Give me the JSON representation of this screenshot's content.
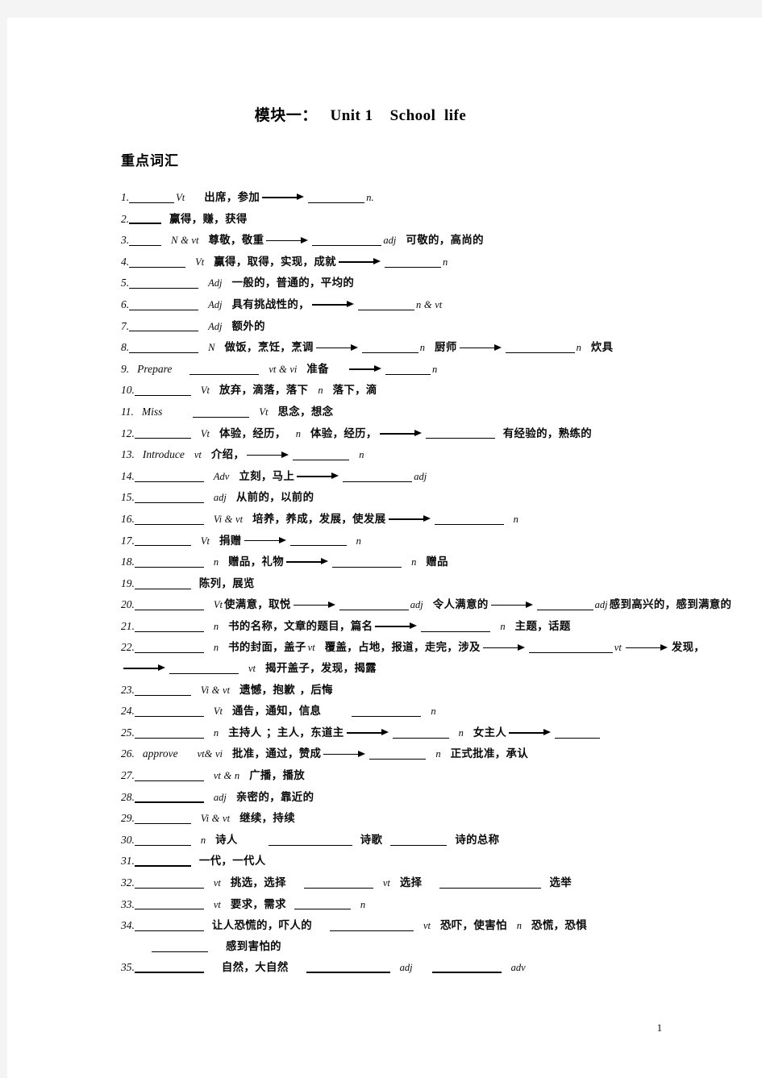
{
  "document": {
    "title": "模块一：   Unit 1    School  life",
    "section_heading": "重点词汇",
    "page_number": "1"
  },
  "entries": [
    {
      "num": "1.",
      "word": "",
      "pos": "Vt",
      "cn": "出席，参加",
      "pos2": "n.",
      "cn2": ""
    },
    {
      "num": "2.",
      "word": "",
      "pos": "",
      "cn": "赢得，赚，获得"
    },
    {
      "num": "3.",
      "word": "",
      "pos": "N & vt",
      "cn": "尊敬，敬重",
      "pos2": "adj",
      "cn2": "可敬的，高尚的"
    },
    {
      "num": "4.",
      "word": "",
      "pos": "Vt",
      "cn": "赢得，取得，实现，成就",
      "pos2": "n"
    },
    {
      "num": "5.",
      "word": "",
      "pos": "Adj",
      "cn": "一般的，普通的，平均的"
    },
    {
      "num": "6.",
      "word": "",
      "pos": "Adj",
      "cn": "具有挑战性的，",
      "pos2": "n & vt"
    },
    {
      "num": "7.",
      "word": "",
      "pos": "Adj",
      "cn": "额外的"
    },
    {
      "num": "8.",
      "word": "",
      "pos": "N",
      "cn": "做饭，烹饪，烹调",
      "pos2": "n",
      "cn2": "厨师",
      "pos3": "n",
      "cn3": "炊具"
    },
    {
      "num": "9.",
      "word": "Prepare",
      "pos": "vt & vi",
      "cn": "准备",
      "pos2": "n"
    },
    {
      "num": "10.",
      "word": "",
      "pos": "Vt",
      "cn": "放弃，滴落，落下",
      "pos2": "n",
      "cn2": "落下，滴"
    },
    {
      "num": "11.",
      "word": "Miss",
      "pos": "Vt",
      "cn": "思念，想念"
    },
    {
      "num": "12.",
      "word": "",
      "pos": "Vt",
      "cn": "体验，经历，",
      "pos2": "n",
      "cn2": "体验，经历，",
      "cn3": "有经验的，熟练的"
    },
    {
      "num": "13.",
      "word": "Introduce",
      "pos": "vt",
      "cn": "介绍，",
      "pos2": "n"
    },
    {
      "num": "14.",
      "word": "",
      "pos": "Adv",
      "cn": "立刻，马上",
      "pos2": "adj"
    },
    {
      "num": "15.",
      "word": "",
      "pos": "adj",
      "cn": "从前的，以前的"
    },
    {
      "num": "16.",
      "word": "",
      "pos": "Vi & vt",
      "cn": "培养，养成，发展，使发展",
      "pos2": "n"
    },
    {
      "num": "17.",
      "word": "",
      "pos": "Vt",
      "cn": "捐赠",
      "pos2": "n"
    },
    {
      "num": "18.",
      "word": "",
      "pos": "n",
      "cn": "赠品，礼物",
      "pos2": "n",
      "cn2": "赠品"
    },
    {
      "num": "19.",
      "word": "",
      "pos": "",
      "cn": "陈列，展览"
    },
    {
      "num": "20.",
      "word": "",
      "pos": "Vt",
      "cn": "使满意，取悦",
      "pos2": "adj",
      "cn2": "令人满意的",
      "pos3": "adj",
      "cn3": "感到高兴的，感到满意的"
    },
    {
      "num": "21.",
      "word": "",
      "pos": "n",
      "cn": "书的名称，文章的题目，篇名",
      "pos2": "n",
      "cn2": "主题，话题"
    },
    {
      "num": "22.",
      "word": "",
      "pos": "n",
      "cn": "书的封面，盖子",
      "pos2": "vt",
      "cn2": "覆盖，占地，报道，走完，涉及",
      "pos3": "vt",
      "cn3": "发现，",
      "pos4": "vt",
      "cn4": "揭开盖子，发现，揭露"
    },
    {
      "num": "23.",
      "word": "",
      "pos": "Vi & vt",
      "cn": "遗憾，抱歉 ，后悔"
    },
    {
      "num": "24.",
      "word": "",
      "pos": "Vt",
      "cn": "通告，通知，信息",
      "pos2": "n"
    },
    {
      "num": "25.",
      "word": "",
      "pos": "n",
      "cn": "主持人 ；主人，东道主",
      "pos2": "n",
      "cn2": "女主人"
    },
    {
      "num": "26.",
      "word": "approve",
      "pos": "vt& vi",
      "cn": "批准，通过，赞成",
      "pos2": "n",
      "cn2": "正式批准，承认"
    },
    {
      "num": "27.",
      "word": "",
      "pos": "vt & n",
      "cn": "广播，播放"
    },
    {
      "num": "28.",
      "word": "",
      "pos": "adj",
      "cn": "亲密的，靠近的"
    },
    {
      "num": "29.",
      "word": "",
      "pos": "Vi & vt",
      "cn": "继续，持续"
    },
    {
      "num": "30.",
      "word": "",
      "pos": "n",
      "cn": "诗人",
      "cn2": "诗歌",
      "cn3": "诗的总称"
    },
    {
      "num": "31.",
      "word": "",
      "pos": "",
      "cn": "一代，一代人"
    },
    {
      "num": "32.",
      "word": "",
      "pos": "vt",
      "cn": "挑选，选择",
      "pos2": "vt",
      "cn2": "选择",
      "cn3": "选举"
    },
    {
      "num": "33.",
      "word": "",
      "pos": "vt",
      "cn": "要求，需求",
      "pos2": "n"
    },
    {
      "num": "34.",
      "word": "",
      "pos": "",
      "cn": "让人恐慌的，吓人的",
      "pos2": "vt",
      "cn2": "恐吓，使害怕",
      "pos3": "n",
      "cn3": "恐慌，恐惧",
      "cn4": "感到害怕的"
    },
    {
      "num": "35.",
      "word": "",
      "pos": "",
      "cn": "自然，大自然",
      "pos2": "adj",
      "pos3": "adv"
    }
  ]
}
